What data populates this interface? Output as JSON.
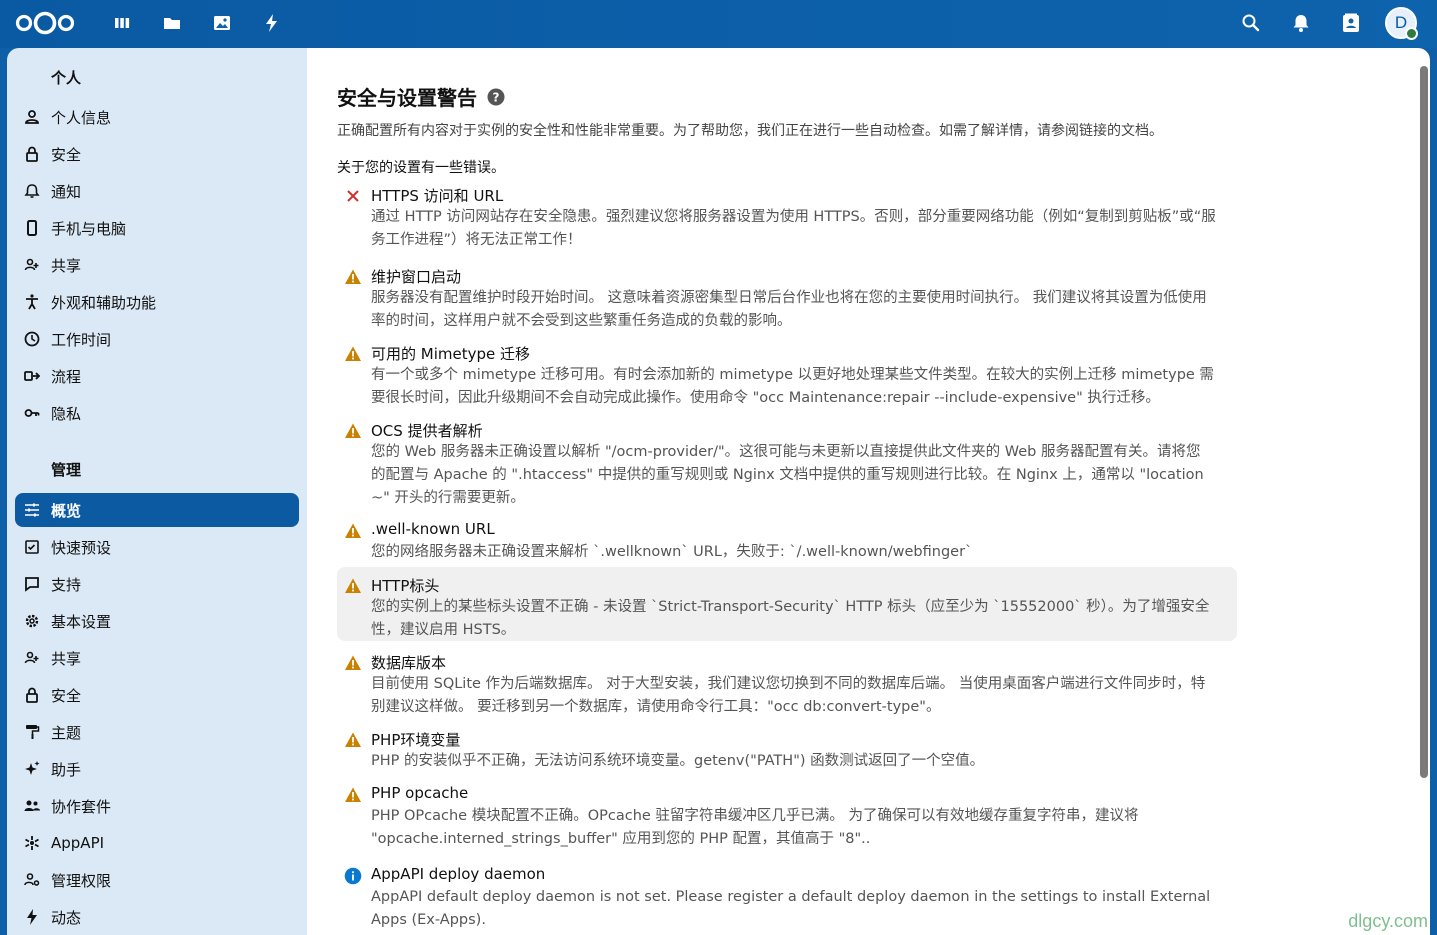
{
  "topbar": {
    "apps": [
      "dashboard-icon",
      "files-icon",
      "photos-icon",
      "activity-icon"
    ],
    "avatar_letter": "D"
  },
  "sidebar": {
    "personal_title": "个人",
    "personal_items": [
      {
        "label": "个人信息",
        "icon": "user-icon"
      },
      {
        "label": "安全",
        "icon": "lock-icon"
      },
      {
        "label": "通知",
        "icon": "bell-icon"
      },
      {
        "label": "手机与电脑",
        "icon": "phone-icon"
      },
      {
        "label": "共享",
        "icon": "share-icon"
      },
      {
        "label": "外观和辅助功能",
        "icon": "accessibility-icon"
      },
      {
        "label": "工作时间",
        "icon": "clock-icon"
      },
      {
        "label": "流程",
        "icon": "flow-icon"
      },
      {
        "label": "隐私",
        "icon": "key-icon"
      }
    ],
    "admin_title": "管理",
    "admin_items": [
      {
        "label": "概览",
        "icon": "sliders-icon",
        "active": true
      },
      {
        "label": "快速预设",
        "icon": "checklist-icon"
      },
      {
        "label": "支持",
        "icon": "chat-icon"
      },
      {
        "label": "基本设置",
        "icon": "gear-icon"
      },
      {
        "label": "共享",
        "icon": "share-icon"
      },
      {
        "label": "安全",
        "icon": "lock-icon"
      },
      {
        "label": "主题",
        "icon": "paint-roller-icon"
      },
      {
        "label": "助手",
        "icon": "sparkle-icon"
      },
      {
        "label": "协作套件",
        "icon": "group-icon"
      },
      {
        "label": "AppAPI",
        "icon": "api-icon"
      },
      {
        "label": "管理权限",
        "icon": "admin-icon"
      },
      {
        "label": "动态",
        "icon": "bolt-icon"
      }
    ]
  },
  "main": {
    "title": "安全与设置警告",
    "intro": "正确配置所有内容对于实例的安全性和性能非常重要。为了帮助您，我们正在进行一些自动检查。如需了解详情，请参阅链接的文档。",
    "error_heading": "关于您的设置有一些错误。",
    "checks": [
      {
        "type": "error",
        "title": "HTTPS 访问和 URL",
        "lines": [
          "通过 HTTP 访问网站存在安全隐患。强烈建议您将服务器设置为使用 HTTPS。否则，部分重要网络功能（例如“复制到剪贴板”或“服",
          "务工作进程”）将无法正常工作！"
        ]
      },
      {
        "type": "warning",
        "title": "维护窗口启动",
        "lines": [
          "服务器没有配置维护时段开始时间。 这意味着资源密集型日常后台作业也将在您的主要使用时间执行。 我们建议将其设置为低使用",
          "率的时间，这样用户就不会受到这些繁重任务造成的负载的影响。"
        ]
      },
      {
        "type": "warning",
        "title": "可用的 Mimetype 迁移",
        "lines": [
          "有一个或多个 mimetype 迁移可用。有时会添加新的 mimetype 以更好地处理某些文件类型。在较大的实例上迁移 mimetype 需",
          "要很长时间，因此升级期间不会自动完成此操作。使用命令 \"occ Maintenance:repair --include-expensive\" 执行迁移。"
        ]
      },
      {
        "type": "warning",
        "title": "OCS 提供者解析",
        "lines": [
          "您的 Web 服务器未正确设置以解析 \"/ocm-provider/\"。这很可能与未更新以直接提供此文件夹的 Web 服务器配置有关。请将您",
          "的配置与 Apache 的 \".htaccess\" 中提供的重写规则或 Nginx 文档中提供的重写规则进行比较。在 Nginx 上，通常以 \"location",
          "~\" 开头的行需要更新。"
        ]
      },
      {
        "type": "warning",
        "title": ".well-known URL",
        "lines": [
          "您的网络服务器未正确设置来解析 `.wellknown` URL，失败于: `/.well-known/webfinger`"
        ]
      },
      {
        "type": "warning",
        "title": "HTTP标头",
        "highlight": true,
        "lines": [
          "您的实例上的某些标头设置不正确 - 未设置 `Strict-Transport-Security` HTTP 标头（应至少为 `15552000` 秒）。为了增强安全",
          "性，建议启用 HSTS。"
        ]
      },
      {
        "type": "warning",
        "title": "数据库版本",
        "lines": [
          "目前使用 SQLite 作为后端数据库。 对于大型安装，我们建议您切换到不同的数据库后端。 当使用桌面客户端进行文件同步时，特",
          "别建议这样做。 要迁移到另一个数据库，请使用命令行工具：\"occ db:convert-type\"。"
        ]
      },
      {
        "type": "warning",
        "title": "PHP环境变量",
        "lines": [
          "PHP 的安装似乎不正确，无法访问系统环境变量。getenv(\"PATH\") 函数测试返回了一个空值。"
        ]
      },
      {
        "type": "warning",
        "title": "PHP opcache",
        "lines": [
          "PHP OPcache 模块配置不正确。OPcache 驻留字符串缓冲区几乎已满。 为了确保可以有效地缓存重复字符串，建议将",
          "\"opcache.interned_strings_buffer\" 应用到您的 PHP 配置，其值高于 \"8\".."
        ]
      },
      {
        "type": "info",
        "title": "AppAPI deploy daemon",
        "lines": [
          "AppAPI default deploy daemon is not set. Please register a default deploy daemon in the settings to install External",
          "Apps (Ex-Apps)."
        ]
      }
    ]
  },
  "watermark": "dlgcy.com",
  "colors": {
    "brand": "#0b5aa2",
    "warning": "#c98200",
    "error": "#d32f2f",
    "info": "#0b78d0"
  }
}
